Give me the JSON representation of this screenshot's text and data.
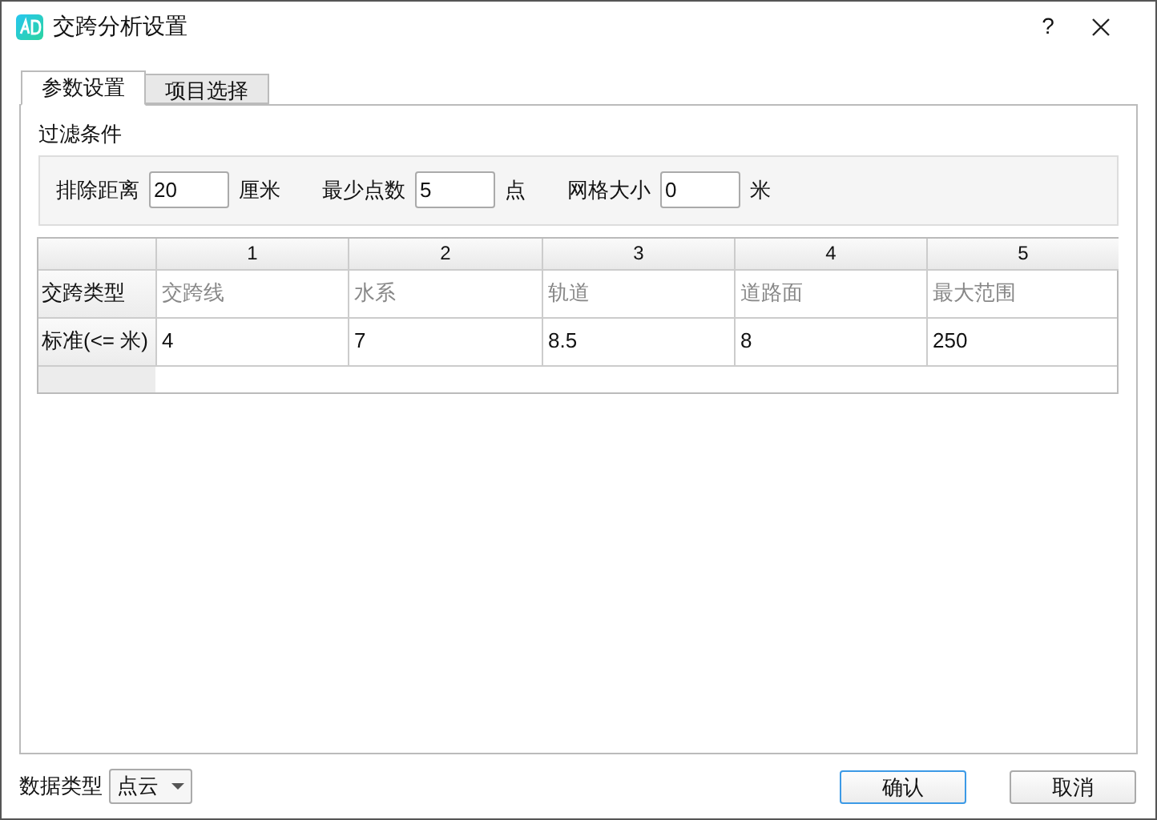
{
  "window": {
    "title": "交跨分析设置",
    "help": "?"
  },
  "tabs": [
    {
      "label": "参数设置",
      "selected": true
    },
    {
      "label": "项目选择",
      "selected": false
    }
  ],
  "filter": {
    "title": "过滤条件",
    "fields": [
      {
        "label": "排除距离",
        "value": "20",
        "unit": "厘米"
      },
      {
        "label": "最少点数",
        "value": "5",
        "unit": "点"
      },
      {
        "label": "网格大小",
        "value": "0",
        "unit": "米"
      }
    ]
  },
  "table": {
    "columns": [
      "1",
      "2",
      "3",
      "4",
      "5"
    ],
    "rows": [
      {
        "header": "交跨类型",
        "muted": true,
        "cells": [
          "交跨线",
          "水系",
          "轨道",
          "道路面",
          "最大范围"
        ]
      },
      {
        "header": "标准(<= 米)",
        "muted": false,
        "cells": [
          "4",
          "7",
          "8.5",
          "8",
          "250"
        ]
      }
    ]
  },
  "footer": {
    "data_type_label": "数据类型",
    "data_type_value": "点云",
    "buttons": [
      {
        "label": "确认",
        "default": true
      },
      {
        "label": "取消",
        "default": false
      }
    ]
  }
}
